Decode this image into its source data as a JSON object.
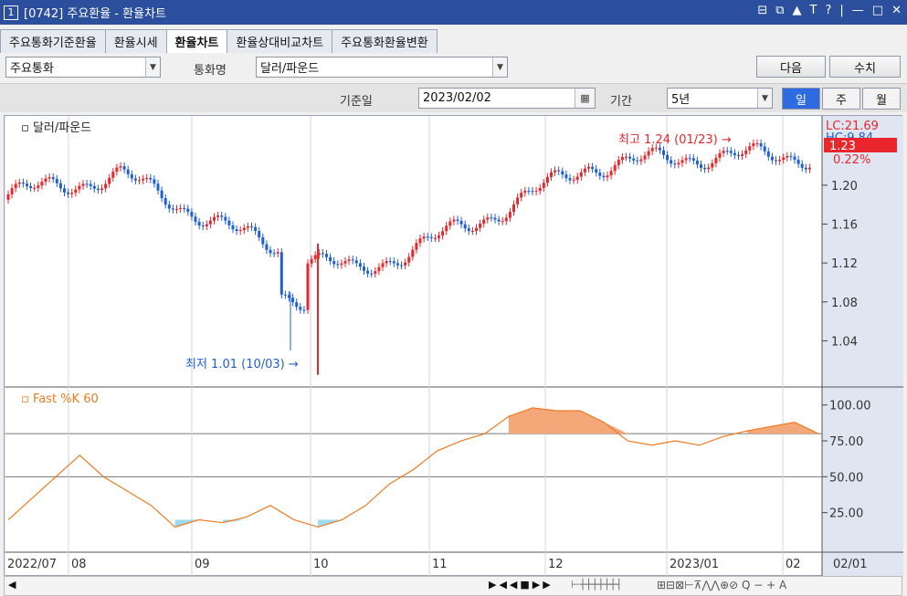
{
  "window": {
    "number": "1",
    "title": "[0742] 주요환율 - 환율차트",
    "controls": [
      "⊟",
      "⧉",
      "▲",
      "T",
      "?",
      "|",
      "—",
      "□",
      "✕"
    ]
  },
  "tabs": [
    "주요통화기준환율",
    "환율시세",
    "환율차트",
    "환율상대비교차트",
    "주요통화환율변환"
  ],
  "active_tab": "환율차트",
  "toolbar": {
    "group_select": "주요통화",
    "currency_label": "통화명",
    "currency_select": "달러/파운드",
    "next_button": "다음",
    "value_button": "수치"
  },
  "query": {
    "base_date_label": "기준일",
    "base_date": "2023/02/02",
    "period_label": "기간",
    "period_select": "5년",
    "period_buttons": [
      "일",
      "주",
      "월"
    ],
    "active_period": "일"
  },
  "price_panel": {
    "legend": "달러/파운드",
    "lc": "LC:21.69",
    "hc": "HC:9.84",
    "current": "1.23",
    "change_pct": "0.22%",
    "high_annot": "최고 1.24 (01/23)",
    "low_annot": "최저 1.01 (10/03)",
    "yticks": [
      "1.20",
      "1.16",
      "1.12",
      "1.08",
      "1.04"
    ]
  },
  "osc_panel": {
    "legend": "Fast %K 60",
    "yticks": [
      "100.00",
      "75.00",
      "50.00",
      "25.00"
    ]
  },
  "xaxis": {
    "labels": [
      "2022/07",
      "08",
      "09",
      "10",
      "11",
      "12",
      "2023/01",
      "02"
    ],
    "right_label": "02/01"
  },
  "colors": {
    "up": "#e8262b",
    "down": "#1f5fd6",
    "osc_line": "#f07a1e",
    "osc_over": "#f4a87a",
    "osc_under": "#9ed9ef",
    "accent": "#2b4f9c"
  },
  "chart_data": [
    {
      "type": "candlestick",
      "title": "달러/파운드",
      "ylim": [
        1.0,
        1.26
      ],
      "x": [
        "2022/07",
        "2022/08",
        "2022/09",
        "2022/10",
        "2022/11",
        "2022/12",
        "2023/01",
        "2023/02"
      ],
      "close_approx": [
        1.19,
        1.21,
        1.15,
        1.11,
        1.16,
        1.22,
        1.23,
        1.23
      ],
      "high": 1.24,
      "low": 1.01
    },
    {
      "type": "line",
      "title": "Fast %K 60",
      "ylim": [
        0,
        110
      ],
      "values": [
        20,
        35,
        50,
        65,
        50,
        40,
        30,
        15,
        20,
        18,
        22,
        30,
        20,
        15,
        20,
        30,
        45,
        55,
        68,
        75,
        80,
        92,
        98,
        96,
        96,
        88,
        75,
        72,
        75,
        72,
        78,
        82,
        85,
        88,
        80
      ]
    }
  ]
}
